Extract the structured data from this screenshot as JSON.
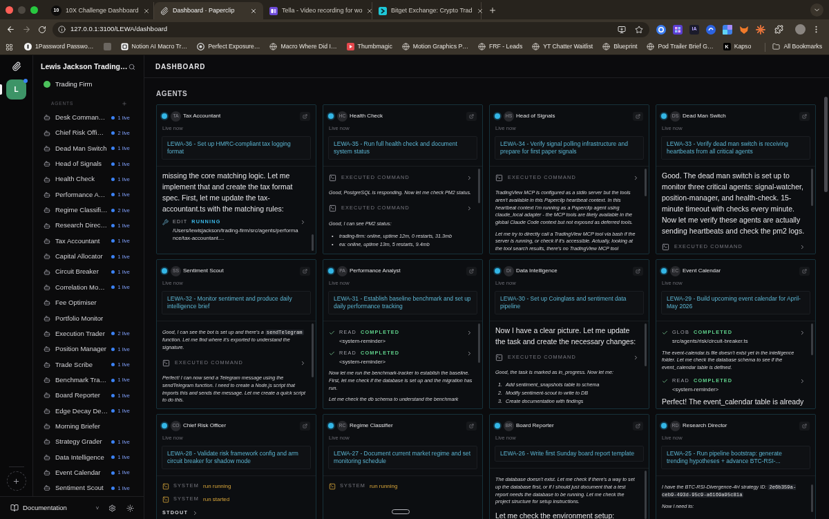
{
  "browser": {
    "tabs": [
      {
        "title": "10X Challenge Dashboard",
        "favicon_text": "10",
        "selected": false
      },
      {
        "title": "Dashboard · Paperclip",
        "selected": true
      },
      {
        "title": "Tella - Video recording for wo",
        "selected": false
      },
      {
        "title": "Bitget Exchange: Crypto Trad",
        "selected": false
      }
    ],
    "url": "127.0.0.1:3100/LEWA/dashboard",
    "extensions": [
      {
        "kind": "logo"
      },
      {
        "kind": "logo"
      },
      {
        "kind": "text",
        "text": "IA"
      },
      {
        "kind": "logo"
      },
      {
        "kind": "logo"
      },
      {
        "kind": "logo"
      },
      {
        "kind": "logo"
      }
    ],
    "bookmarks": [
      {
        "kind": "link",
        "title": "1Password Passwo…"
      },
      {
        "kind": "icon"
      },
      {
        "kind": "link",
        "title": "Notion AI Macro Tr…"
      },
      {
        "kind": "link",
        "title": "Perfect Exposure…"
      },
      {
        "kind": "link",
        "title": "Macro Where Did I…"
      },
      {
        "kind": "link",
        "title": "Thumbmagic"
      },
      {
        "kind": "link",
        "title": "Motion Graphics P…"
      },
      {
        "kind": "link",
        "title": "FRF - Leads"
      },
      {
        "kind": "link",
        "title": "YT Chatter Waitlist"
      },
      {
        "kind": "link",
        "title": "Blueprint"
      },
      {
        "kind": "link",
        "title": "Pod Trailer Brief G…"
      },
      {
        "kind": "link",
        "title": "Kapso",
        "favicon_text": "K"
      }
    ],
    "all_bookmarks": "All Bookmarks"
  },
  "rail": {
    "company_initial": "L",
    "selected": true,
    "unread": true
  },
  "sidebar": {
    "company": "Lewis Jackson Trading…",
    "project": "Trading Firm",
    "section": "AGENTS",
    "agents": [
      {
        "name": "Desk Comman…",
        "live": "1 live"
      },
      {
        "name": "Chief Risk Offi…",
        "live": "2 live"
      },
      {
        "name": "Dead Man Switch",
        "live": "1 live"
      },
      {
        "name": "Head of Signals",
        "live": "1 live"
      },
      {
        "name": "Health Check",
        "live": "1 live"
      },
      {
        "name": "Performance A…",
        "live": "1 live"
      },
      {
        "name": "Regime Classifi…",
        "live": "2 live"
      },
      {
        "name": "Research Direc…",
        "live": "1 live"
      },
      {
        "name": "Tax Accountant",
        "live": "1 live"
      },
      {
        "name": "Capital Allocator",
        "live": "1 live"
      },
      {
        "name": "Circuit Breaker",
        "live": "1 live"
      },
      {
        "name": "Correlation Mo…",
        "live": "1 live"
      },
      {
        "name": "Fee Optimiser"
      },
      {
        "name": "Portfolio Monitor"
      },
      {
        "name": "Execution Trader",
        "live": "2 live"
      },
      {
        "name": "Position Manager",
        "live": "1 live"
      },
      {
        "name": "Trade Scribe",
        "live": "1 live"
      },
      {
        "name": "Benchmark Tra…",
        "live": "1 live"
      },
      {
        "name": "Board Reporter",
        "live": "1 live"
      },
      {
        "name": "Edge Decay De…",
        "live": "1 live"
      },
      {
        "name": "Morning Briefer"
      },
      {
        "name": "Strategy Grader",
        "live": "1 live"
      },
      {
        "name": "Data Intelligence",
        "live": "1 live"
      },
      {
        "name": "Event Calendar",
        "live": "1 live"
      },
      {
        "name": "Sentiment Scout",
        "live": "1 live"
      }
    ]
  },
  "footer": {
    "docs": "Documentation",
    "version": "v"
  },
  "page": {
    "title": "DASHBOARD",
    "section": "AGENTS",
    "cards": [
      {
        "initials": "TA",
        "name": "Tax Accountant",
        "status": "Live now",
        "issue": "LEWA-36 - Set up HMRC-compliant tax logging format",
        "transcript": [
          {
            "kind": "prose",
            "text": "missing the core matching logic. Let me implement that and create the tax format spec. First, let me update the tax-accountant.ts with the matching rules:"
          },
          {
            "kind": "tool",
            "action": "EDIT",
            "status": "RUNNING",
            "completed": false,
            "detail": "/Users/lewisjackson/trading-firm/src/agents/performance/tax-accountant...."
          }
        ]
      },
      {
        "initials": "HC",
        "name": "Health Check",
        "status": "Live now",
        "issue": "LEWA-35 - Run full health check and document system status",
        "transcript": [
          {
            "kind": "command",
            "label": "EXECUTED COMMAND"
          },
          {
            "kind": "note",
            "text": "Good, PostgreSQL is responding. Now let me check PM2 status."
          },
          {
            "kind": "command",
            "label": "EXECUTED COMMAND"
          },
          {
            "kind": "note",
            "text": "Good, I can see PM2 status:"
          },
          {
            "kind": "list",
            "items": [
              {
                "marker": "•",
                "text": "trading-firm: online, uptime 12m, 0 restarts, 31.3mb"
              },
              {
                "marker": "•",
                "text": "ea: online, uptime 13m, 5 restarts, 9.4mb"
              }
            ]
          }
        ]
      },
      {
        "initials": "HS",
        "name": "Head of Signals",
        "status": "Live now",
        "issue": "LEWA-34 - Verify signal polling infrastructure and prepare for first paper signals",
        "transcript": [
          {
            "kind": "command",
            "label": "EXECUTED COMMAND"
          },
          {
            "kind": "note",
            "text": "TradingView MCP is configured as a stdio server but the tools aren't available in this Paperclip heartbeat context. In this heartbeat context I'm running as a Paperclip agent using claude_local adapter - the MCP tools are likely available in the global Claude Code context but not exposed as deferred tools."
          },
          {
            "kind": "note",
            "text": "Let me try to directly call a TradingView MCP tool via bash if the server is running, or check if it's accessible. Actually, looking at the tool search results, there's no TradingView MCP tool"
          }
        ]
      },
      {
        "initials": "DS",
        "name": "Dead Man Switch",
        "status": "Live now",
        "issue": "LEWA-33 - Verify dead man switch is receiving heartbeats from all critical agents",
        "transcript": [
          {
            "kind": "prose",
            "text": "Good. The dead man switch is set up to monitor three critical agents: signal-watcher, position-manager, and health-check. 15-minute timeout with checks every minute. Now let me verify these agents are actually sending heartbeats and check the pm2 logs."
          },
          {
            "kind": "command",
            "label": "EXECUTED COMMAND"
          }
        ]
      },
      {
        "initials": "SS",
        "name": "Sentiment Scout",
        "status": "Live now",
        "issue": "LEWA-32 - Monitor sentiment and produce daily intelligence brief",
        "transcript": [
          {
            "kind": "note",
            "parts": [
              {
                "text": "Good, I can see the bot is set up and there's a ",
                "code": false
              },
              {
                "text": "sendTelegram",
                "code": true
              },
              {
                "text": " function. Let me find where it's exported to understand the signature.",
                "code": false
              }
            ]
          },
          {
            "kind": "command",
            "label": "EXECUTED COMMAND"
          },
          {
            "kind": "note",
            "text": "Perfect! I can now send a Telegram message using the sendTelegram function. I need to create a Node.js script that imports this and sends the message. Let me create a quick script to do this."
          }
        ]
      },
      {
        "initials": "PA",
        "name": "Performance Analyst",
        "status": "Live now",
        "issue": "LEWA-31 - Establish baseline benchmark and set up daily performance tracking",
        "transcript": [
          {
            "kind": "tool",
            "action": "READ",
            "status": "COMPLETED",
            "completed": true,
            "detail": "<system-reminder>"
          },
          {
            "kind": "tool",
            "action": "READ",
            "status": "COMPLETED",
            "completed": true,
            "detail": "<system-reminder>"
          },
          {
            "kind": "note",
            "text": "Now let me run the benchmark-tracker to establish the baseline. First, let me check if the database is set up and the migration has run."
          },
          {
            "kind": "note",
            "text": "Let me check the db schema to understand the benchmark"
          }
        ]
      },
      {
        "initials": "DI",
        "name": "Data Intelligence",
        "status": "Live now",
        "issue": "LEWA-30 - Set up Coinglass and sentiment data pipeline",
        "transcript": [
          {
            "kind": "prose",
            "text": "Now I have a clear picture. Let me update the task and create the necessary changes:"
          },
          {
            "kind": "command",
            "label": "EXECUTED COMMAND"
          },
          {
            "kind": "note",
            "text": "Good, the task is marked as in_progress. Now let me:"
          },
          {
            "kind": "list",
            "items": [
              {
                "marker": "1.",
                "text": "Add sentiment_snapshots table to schema"
              },
              {
                "marker": "2.",
                "text": "Modify sentiment-scout to write to DB"
              },
              {
                "marker": "3.",
                "text": "Create documentation with findings"
              }
            ]
          }
        ]
      },
      {
        "initials": "EC",
        "name": "Event Calendar",
        "status": "Live now",
        "issue": "LEWA-29 - Build upcoming event calendar for April-May 2026",
        "transcript": [
          {
            "kind": "tool",
            "action": "GLOB",
            "status": "COMPLETED",
            "completed": true,
            "detail": "src/agents/risk/circuit-breaker.ts"
          },
          {
            "kind": "note",
            "text": "The event-calendar.ts file doesn't exist yet in the intelligence folder. Let me check the database schema to see if the event_calendar table is defined."
          },
          {
            "kind": "tool",
            "action": "READ",
            "status": "COMPLETED",
            "completed": true,
            "detail": "<system-reminder>"
          },
          {
            "kind": "prose",
            "text": "Perfect! The event_calendar table is already"
          }
        ]
      },
      {
        "initials": "CO",
        "name": "Chief Risk Officer",
        "status": "Live now",
        "issue": "LEWA-28 - Validate risk framework config and arm circuit breaker for shadow mode",
        "transcript": [
          {
            "kind": "system",
            "label": "SYSTEM",
            "message": "run running"
          },
          {
            "kind": "system",
            "label": "SYSTEM",
            "message": "run started"
          },
          {
            "kind": "stdout",
            "label": "STDOUT"
          }
        ]
      },
      {
        "initials": "RC",
        "name": "Regime Classifier",
        "status": "Live now",
        "issue": "LEWA-27 - Document current market regime and set monitoring schedule",
        "transcript": [
          {
            "kind": "system",
            "label": "SYSTEM",
            "message": "run running"
          },
          {
            "kind": "handle"
          }
        ]
      },
      {
        "initials": "BR",
        "name": "Board Reporter",
        "status": "Live now",
        "issue": "LEWA-26 - Write first Sunday board report template",
        "transcript": [
          {
            "kind": "note",
            "text": "The database doesn't exist. Let me check if there's a way to set up the database first, or if I should just document that a test report needs the database to be running. Let me check the project structure for setup instructions."
          },
          {
            "kind": "prose",
            "text": "Let me check the environment setup:"
          }
        ]
      },
      {
        "initials": "RD",
        "name": "Research Director",
        "status": "Live now",
        "issue": "LEWA-25 - Run pipeline bootstrap: generate trending hypotheses + advance BTC-RSI-...",
        "transcript": [
          {
            "kind": "note",
            "parts": [
              {
                "text": "I have the BTC-RSI-Divergence-4H strategy ID: ",
                "code": false
              },
              {
                "text": "2e6b359a-ceb9-493d-95c9-a6169a95c81a",
                "code": true
              }
            ]
          },
          {
            "kind": "note",
            "text": "Now I need to:"
          }
        ]
      }
    ]
  }
}
